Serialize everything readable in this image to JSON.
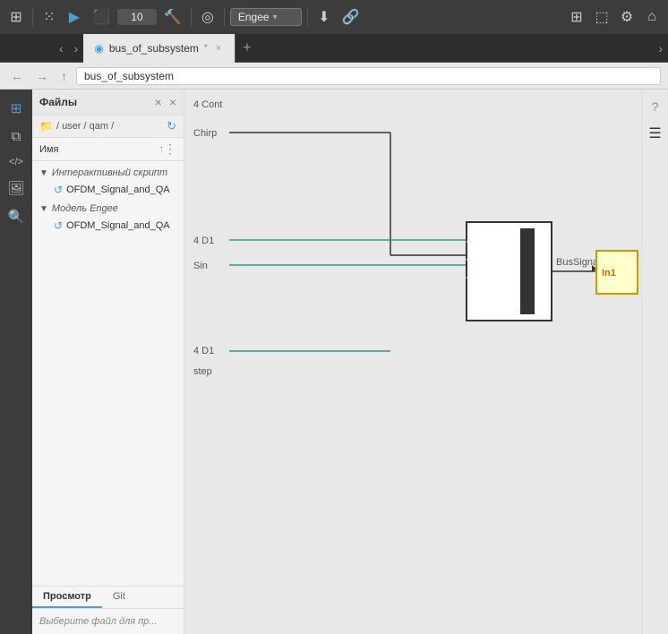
{
  "toolbar": {
    "run_icon": "▶",
    "stop_icon": "⬛",
    "step_count": "10",
    "build_icon": "🔨",
    "model_icon": "◎",
    "engine_label": "Engee",
    "dropdown_arrow": "▾",
    "fold_icon": "⬇",
    "link_icon": "🔗",
    "grid_icon": "⊞",
    "export_icon": "↗",
    "settings_icon": "⚙",
    "home_icon": "⌂"
  },
  "tabs": [
    {
      "id": "bus_of_subsystem",
      "label": "bus_of_subsystem",
      "active": true,
      "modified": true
    },
    {
      "id": "add",
      "label": "+",
      "active": false
    }
  ],
  "address_bar": {
    "back": "←",
    "forward": "→",
    "up": "↑",
    "path": "bus_of_subsystem"
  },
  "sidebar_icons": [
    {
      "id": "grid",
      "icon": "⊞"
    },
    {
      "id": "layers",
      "icon": "⧉"
    },
    {
      "id": "code",
      "icon": "</>"
    },
    {
      "id": "image",
      "icon": "🖼"
    },
    {
      "id": "search",
      "icon": "🔍"
    }
  ],
  "file_panel": {
    "title": "Файлы",
    "close": "×",
    "path": "/ user / qam /",
    "refresh_icon": "↺",
    "col_name": "Имя",
    "col_sort": "↑",
    "col_menu_icon": "⋮",
    "sections": [
      {
        "id": "interactive",
        "label": "Интерактивный скрипт",
        "items": [
          {
            "label": "OFDM_Signal_and_QA",
            "icon": "↺"
          }
        ]
      },
      {
        "id": "engee_model",
        "label": "Модель Engee",
        "items": [
          {
            "label": "OFDM_Signal_and_QA",
            "icon": "↺"
          }
        ]
      }
    ]
  },
  "preview_panel": {
    "tabs": [
      {
        "id": "preview",
        "label": "Просмотр",
        "active": true
      },
      {
        "id": "git",
        "label": "Git",
        "active": false
      }
    ],
    "placeholder": "Выберите файл для пр..."
  },
  "right_icons": [
    {
      "id": "help",
      "icon": "?"
    },
    {
      "id": "filter",
      "icon": "☰"
    }
  ],
  "diagram": {
    "labels": {
      "cont1": "4 Cont",
      "chirp": "Chirp",
      "d1_top": "4 D1",
      "sin": "Sin",
      "bus_signal": "BusSignal Cont",
      "in1": "In1",
      "d1_bottom": "4 D1",
      "step": "step"
    },
    "colors": {
      "bus_block_border": "#333333",
      "subsystem_border": "#cc9900",
      "subsystem_bg": "#ffffcc",
      "wire_teal": "#2a9d8f",
      "wire_dark": "#333333"
    }
  }
}
